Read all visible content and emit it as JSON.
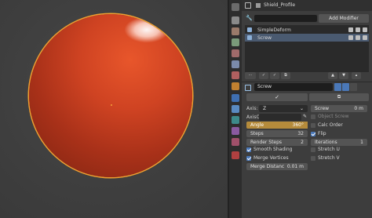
{
  "window": {
    "object_name": "Shield_Profile"
  },
  "modifier_panel": {
    "add_modifier_label": "Add Modifier",
    "stack": [
      {
        "name": "SimpleDeform",
        "selected": false
      },
      {
        "name": "Screw",
        "selected": true
      }
    ]
  },
  "screw": {
    "name": "Screw",
    "apply_label": "✓",
    "copy_label": "⧉",
    "axis": {
      "label": "Axis:",
      "value": "Z"
    },
    "axis_object": {
      "label": "AxisO",
      "value": ""
    },
    "angle": {
      "label": "Angle",
      "value": "360°"
    },
    "steps": {
      "label": "Steps",
      "value": "32"
    },
    "render_steps": {
      "label": "Render Steps",
      "value": "2"
    },
    "smooth_shading": {
      "label": "Smooth Shading",
      "checked": true
    },
    "merge_vertices": {
      "label": "Merge Vertices",
      "checked": true
    },
    "merge_distance": {
      "label": "Merge Distanc",
      "value": "0.01 m"
    },
    "screw_offset": {
      "label": "Screw",
      "value": "0 m"
    },
    "object_screw": {
      "label": "Object Screw",
      "checked": false
    },
    "calc_order": {
      "label": "Calc Order",
      "checked": false
    },
    "flip": {
      "label": "Flip",
      "checked": true
    },
    "iterations": {
      "label": "Iterations",
      "value": "1"
    },
    "stretch_u": {
      "label": "Stretch U",
      "checked": false
    },
    "stretch_v": {
      "label": "Stretch V",
      "checked": false
    }
  },
  "colors": {
    "accent_blue": "#4a78b8",
    "angle_fill": "#b58b3b",
    "object_outline": "#f0a030"
  }
}
